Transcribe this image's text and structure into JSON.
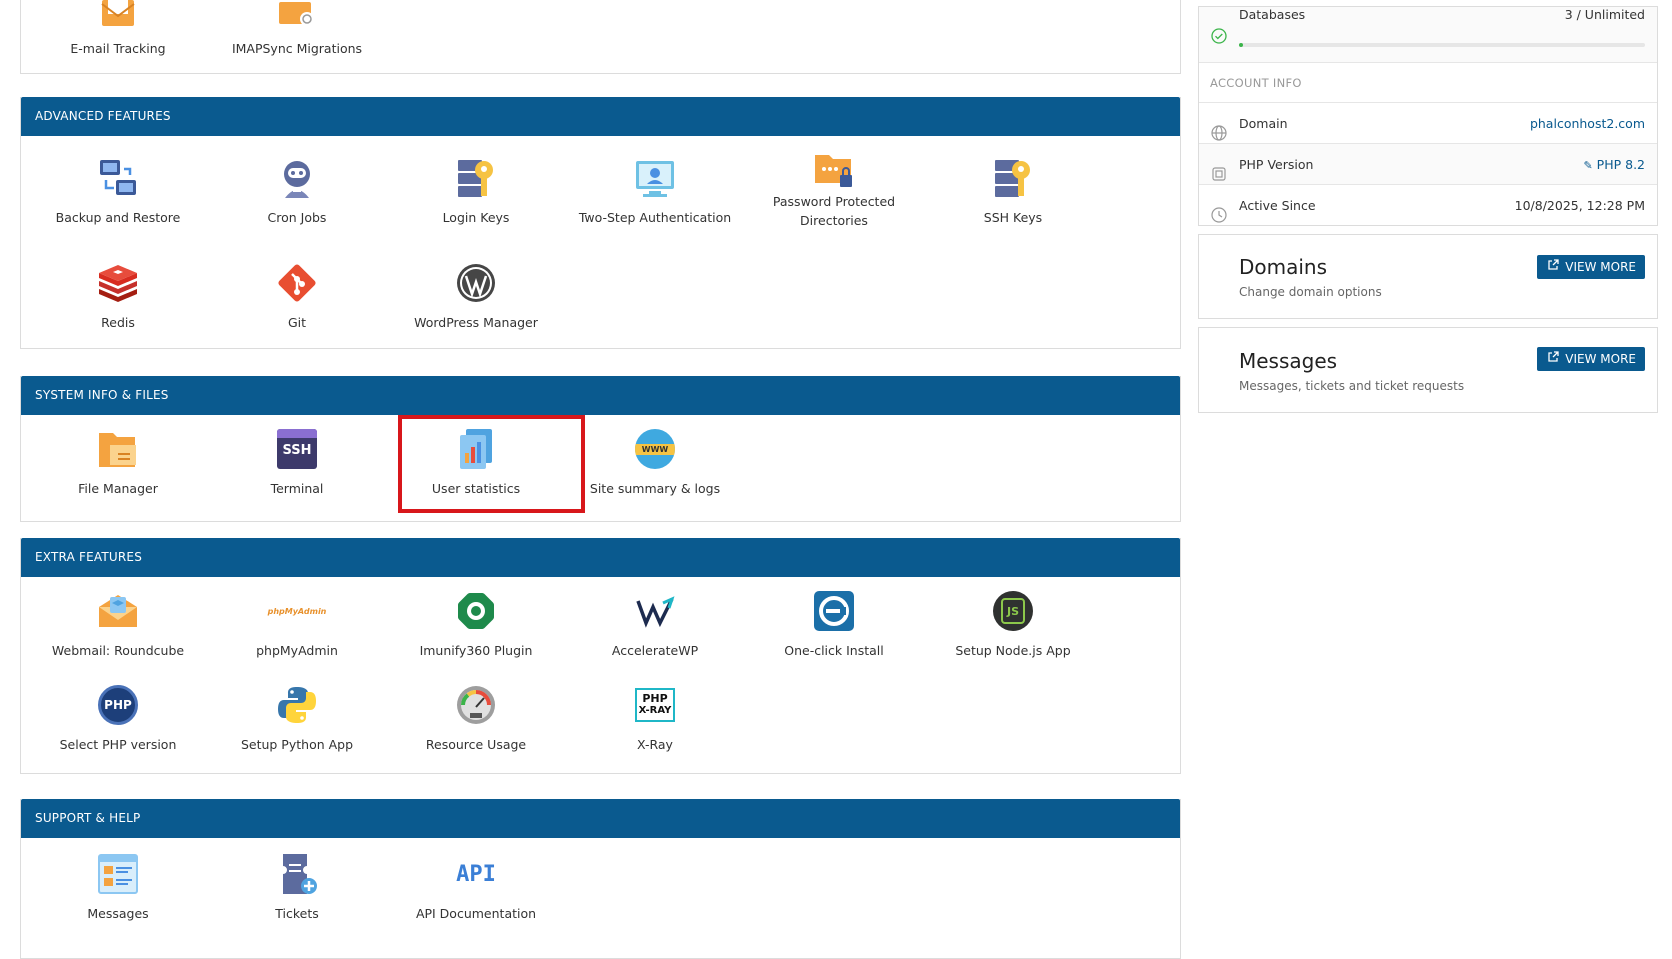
{
  "sections": {
    "email": {
      "items": [
        {
          "label": "E-mail Tracking",
          "icon": "email-tracking-icon"
        },
        {
          "label": "IMAPSync Migrations",
          "icon": "imapsync-icon"
        }
      ]
    },
    "advanced": {
      "title": "ADVANCED FEATURES",
      "items": [
        {
          "label": "Backup and Restore",
          "icon": "backup-icon"
        },
        {
          "label": "Cron Jobs",
          "icon": "cron-icon"
        },
        {
          "label": "Login Keys",
          "icon": "login-keys-icon"
        },
        {
          "label": "Two-Step Authentication",
          "icon": "two-step-icon"
        },
        {
          "label": "Password Protected Directories",
          "icon": "password-folder-icon"
        },
        {
          "label": "SSH Keys",
          "icon": "ssh-keys-icon"
        },
        {
          "label": "Redis",
          "icon": "redis-icon"
        },
        {
          "label": "Git",
          "icon": "git-icon"
        },
        {
          "label": "WordPress Manager",
          "icon": "wordpress-icon"
        }
      ]
    },
    "system": {
      "title": "SYSTEM INFO & FILES",
      "items": [
        {
          "label": "File Manager",
          "icon": "file-manager-icon"
        },
        {
          "label": "Terminal",
          "icon": "terminal-icon",
          "glyph": "SSH"
        },
        {
          "label": "User statistics",
          "icon": "user-statistics-icon"
        },
        {
          "label": "Site summary & logs",
          "icon": "site-summary-icon",
          "glyph": "WWW"
        }
      ]
    },
    "extra": {
      "title": "EXTRA FEATURES",
      "items": [
        {
          "label": "Webmail: Roundcube",
          "icon": "roundcube-icon"
        },
        {
          "label": "phpMyAdmin",
          "icon": "phpmyadmin-icon",
          "glyph": "phpMyAdmin"
        },
        {
          "label": "Imunify360 Plugin",
          "icon": "imunify-icon"
        },
        {
          "label": "AccelerateWP",
          "icon": "acceleratewp-icon"
        },
        {
          "label": "One-click Install",
          "icon": "one-click-install-icon"
        },
        {
          "label": "Setup Node.js App",
          "icon": "nodejs-icon",
          "glyph": "JS"
        },
        {
          "label": "Select PHP version",
          "icon": "php-version-icon",
          "glyph": "PHP"
        },
        {
          "label": "Setup Python App",
          "icon": "python-icon"
        },
        {
          "label": "Resource Usage",
          "icon": "resource-usage-icon"
        },
        {
          "label": "X-Ray",
          "icon": "xray-icon",
          "glyph": "PHP",
          "glyph2": "X-RAY"
        }
      ]
    },
    "support": {
      "title": "SUPPORT & HELP",
      "items": [
        {
          "label": "Messages",
          "icon": "messages-icon"
        },
        {
          "label": "Tickets",
          "icon": "tickets-icon"
        },
        {
          "label": "API Documentation",
          "icon": "api-icon",
          "glyph": "API"
        }
      ]
    }
  },
  "sidebar": {
    "databases": {
      "label": "Databases",
      "value": "3 / Unlimited",
      "progress": 0.01
    },
    "account_info": {
      "title": "ACCOUNT INFO",
      "domain_label": "Domain",
      "domain_value": "phalconhost2.com",
      "php_label": "PHP Version",
      "php_value": "PHP 8.2",
      "active_label": "Active Since",
      "active_value": "10/8/2025, 12:28 PM"
    },
    "domains_card": {
      "title": "Domains",
      "subtitle": "Change domain options",
      "button": "VIEW MORE"
    },
    "messages_card": {
      "title": "Messages",
      "subtitle": "Messages, tickets and ticket requests",
      "button": "VIEW MORE"
    }
  },
  "colors": {
    "header_bg": "#0a5a8f",
    "highlight": "#d8171b",
    "link": "#0a5a8f"
  }
}
